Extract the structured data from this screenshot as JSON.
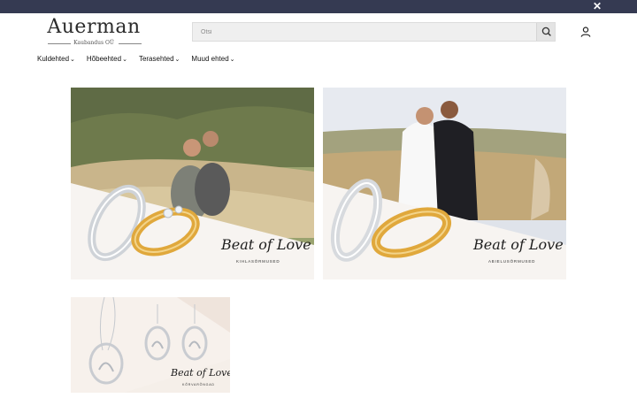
{
  "header": {
    "logo_name": "Auerman",
    "logo_sub": "Kaubandus OÜ",
    "search_placeholder": "Otsi",
    "icons": {
      "close": "close-icon",
      "search": "search-icon",
      "account": "user-icon"
    }
  },
  "nav": {
    "items": [
      {
        "label": "Kuldehted"
      },
      {
        "label": "Hõbeehted"
      },
      {
        "label": "Terasehted"
      },
      {
        "label": "Muud ehted"
      }
    ]
  },
  "banners": [
    {
      "brand": "Beat of Love",
      "tagline": "KIHLASÕRMUSED"
    },
    {
      "brand": "Beat of Love",
      "tagline": "ABIELUSÕRMUSED"
    },
    {
      "brand": "Beat of Love",
      "tagline": "KÕRVARÕNGAD"
    }
  ],
  "colors": {
    "topbar": "#353a52",
    "gold": "#e0a83c",
    "silver": "#d7dade"
  }
}
